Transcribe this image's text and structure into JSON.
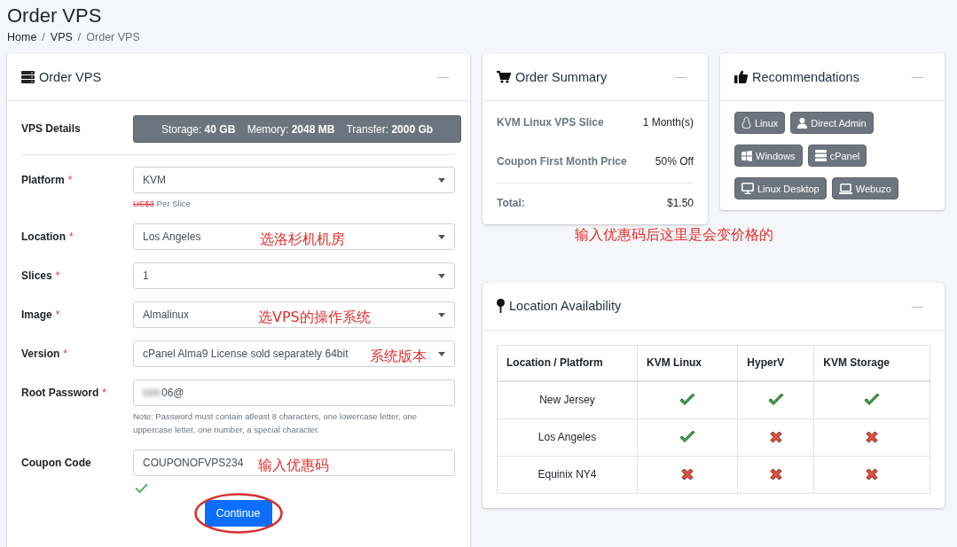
{
  "page": {
    "title": "Order VPS",
    "breadcrumb": [
      "Home",
      "VPS",
      "Order VPS"
    ],
    "breadcrumb_separator": "/"
  },
  "order_form": {
    "title": "Order VPS",
    "collapse": "—",
    "details": {
      "label": "VPS Details",
      "text": "Storage: **40 GB**    Memory: **2048 MB**    Transfer: **2000 Gb**"
    },
    "fields": [
      {
        "kind": "select",
        "label": "Platform",
        "required_mark": "*",
        "value": "KVM",
        "old_price": "US$3",
        "note": "Per Slice"
      },
      {
        "kind": "select",
        "label": "Location",
        "required_mark": "*",
        "value": "Los Angeles",
        "annotation": "选洛杉机机房"
      },
      {
        "kind": "select",
        "label": "Slices",
        "required_mark": "*",
        "value": "1"
      },
      {
        "kind": "select",
        "label": "Image",
        "required_mark": "*",
        "value": "Almalinux",
        "annotation": "选VPS的操作系统"
      },
      {
        "kind": "select",
        "label": "Version",
        "required_mark": "*",
        "value": "cPanel Alma9 License sold separately 64bit",
        "annotation": "系统版本"
      },
      {
        "kind": "password",
        "label": "Root Password",
        "required_mark": "*",
        "value": "06@",
        "note": "Note: Password must contain atleast 8 characters, one lowercase letter, one uppercase letter, one number, a special character."
      },
      {
        "kind": "text",
        "label": "Coupon Code",
        "value": "COUPONOFVPS234",
        "annotation": "输入优惠码",
        "valid": true
      }
    ],
    "submit": "Continue"
  },
  "order_summary": {
    "title": "Order Summary",
    "collapse": "—",
    "rows": [
      {
        "label": "KVM Linux VPS Slice",
        "value": "1 Month(s)"
      },
      {
        "label": "Coupon First Month Price",
        "value": "50% Off"
      }
    ],
    "total": {
      "label": "Total:",
      "value": "$1.50"
    }
  },
  "recommendations": {
    "title": "Recommendations",
    "collapse": "—",
    "buttons": [
      "Linux",
      "Direct Admin",
      "Windows",
      "cPanel",
      "Linux Desktop",
      "Webuzo"
    ]
  },
  "location_availability": {
    "title": "Location Availability",
    "collapse": "—",
    "columns": [
      "Location / Platform",
      "KVM Linux",
      "HyperV",
      "KVM Storage"
    ],
    "rows": [
      {
        "location": "New Jersey",
        "available": [
          true,
          true,
          true
        ]
      },
      {
        "location": "Los Angeles",
        "available": [
          true,
          false,
          false
        ]
      },
      {
        "location": "Equinix NY4",
        "available": [
          false,
          false,
          false
        ]
      }
    ]
  },
  "annotations": [
    {
      "text": "输入优惠码后这里是会变价格的"
    }
  ]
}
